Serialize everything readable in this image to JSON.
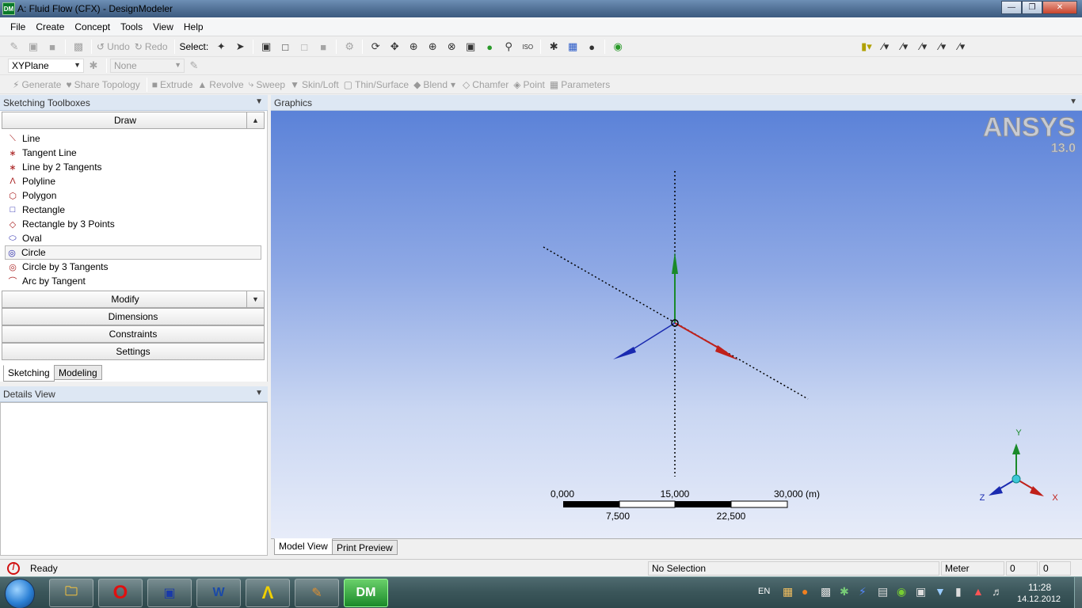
{
  "window": {
    "title": "A: Fluid Flow (CFX) - DesignModeler",
    "app_icon_text": "DM"
  },
  "menu": [
    "File",
    "Create",
    "Concept",
    "Tools",
    "View",
    "Help"
  ],
  "toolbar1": {
    "undo_label": "Undo",
    "redo_label": "Redo",
    "select_label": "Select:"
  },
  "toolbar2": {
    "plane_value": "XYPlane",
    "sketch_value": "None"
  },
  "toolbar3": [
    "Generate",
    "Share Topology",
    "Extrude",
    "Revolve",
    "Sweep",
    "Skin/Loft",
    "Thin/Surface",
    "Blend",
    "Chamfer",
    "Point",
    "Parameters"
  ],
  "left_panel": {
    "title": "Sketching Toolboxes",
    "draw_label": "Draw",
    "draw_items": [
      "Line",
      "Tangent Line",
      "Line by 2 Tangents",
      "Polyline",
      "Polygon",
      "Rectangle",
      "Rectangle by 3 Points",
      "Oval",
      "Circle",
      "Circle by 3 Tangents",
      "Arc by Tangent"
    ],
    "sections": [
      "Modify",
      "Dimensions",
      "Constraints",
      "Settings"
    ],
    "tabs": [
      "Sketching",
      "Modeling"
    ],
    "details_title": "Details View"
  },
  "graphics": {
    "title": "Graphics",
    "brand": "ANSYS",
    "version": "13.0",
    "scale_top": [
      "0,000",
      "15,000",
      "30,000 (m)"
    ],
    "scale_bottom": [
      "7,500",
      "22,500"
    ],
    "axis_labels": {
      "x": "X",
      "y": "Y",
      "z": "Z"
    },
    "tabs": [
      "Model View",
      "Print Preview"
    ]
  },
  "status": {
    "ready": "Ready",
    "selection": "No Selection",
    "unit": "Meter",
    "val1": "0",
    "val2": "0"
  },
  "taskbar": {
    "lang": "EN",
    "time": "11:28",
    "date": "14.12.2012",
    "dm_label": "DM"
  },
  "colors": {
    "accent": "#dde7f3",
    "x_axis": "#c0201a",
    "y_axis": "#1a8a2a",
    "z_axis": "#1a2ab0"
  }
}
